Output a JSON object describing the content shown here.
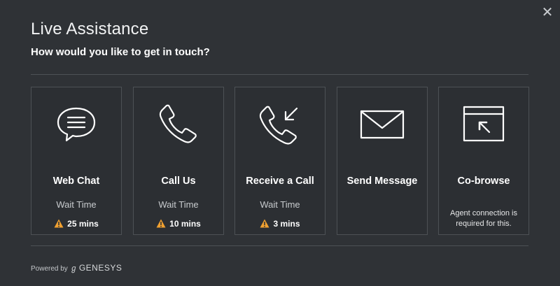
{
  "dialog": {
    "close_glyph": "✕",
    "title": "Live Assistance",
    "subtitle": "How would you like to get in touch?"
  },
  "options": [
    {
      "icon": "chat-bubble-icon",
      "label": "Web Chat",
      "wait_label": "Wait Time",
      "wait_value": "25 mins"
    },
    {
      "icon": "phone-icon",
      "label": "Call Us",
      "wait_label": "Wait Time",
      "wait_value": "10 mins"
    },
    {
      "icon": "phone-incoming-icon",
      "label": "Receive a Call",
      "wait_label": "Wait Time",
      "wait_value": "3 mins"
    },
    {
      "icon": "envelope-icon",
      "label": "Send Message"
    },
    {
      "icon": "cobrowse-window-icon",
      "label": "Co-browse",
      "note": "Agent connection is required for this."
    }
  ],
  "footer": {
    "powered_by": "Powered by",
    "logo_glyph": "ℊ",
    "brand": "GENESYS"
  },
  "colors": {
    "background": "#2f3236",
    "card_border": "#4d5155",
    "warning": "#f0a030",
    "text": "#ffffff"
  }
}
